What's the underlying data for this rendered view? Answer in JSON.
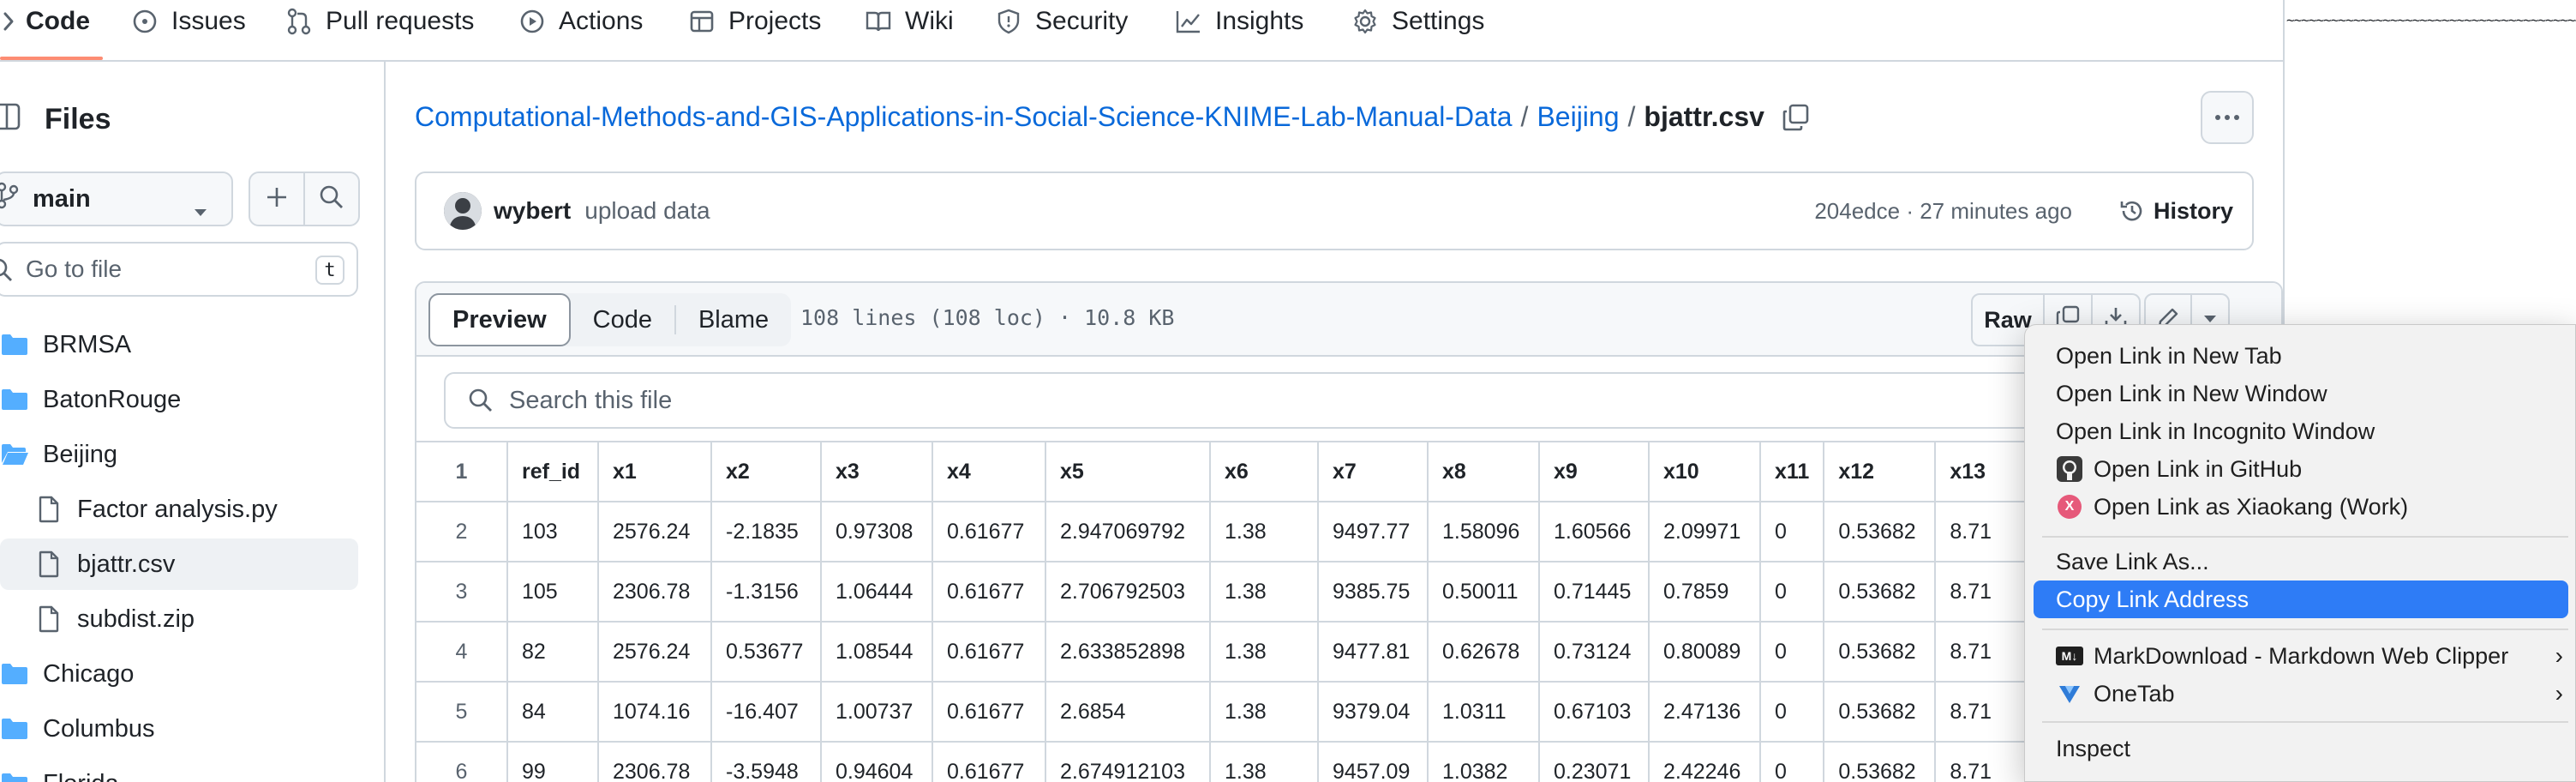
{
  "nav": {
    "tabs": [
      {
        "label": "Code",
        "icon": "code-icon",
        "active": true
      },
      {
        "label": "Issues",
        "icon": "issue-circle-icon"
      },
      {
        "label": "Pull requests",
        "icon": "pull-request-icon"
      },
      {
        "label": "Actions",
        "icon": "play-circle-icon"
      },
      {
        "label": "Projects",
        "icon": "table-icon"
      },
      {
        "label": "Wiki",
        "icon": "book-icon"
      },
      {
        "label": "Security",
        "icon": "shield-icon"
      },
      {
        "label": "Insights",
        "icon": "graph-icon"
      },
      {
        "label": "Settings",
        "icon": "gear-icon"
      }
    ],
    "overflow_text": "~~~~~~~~~~~~~~~~~~~~~~~~~~~~~~~~~~~~~~~~~~~~~~~~~~~~"
  },
  "sidebar": {
    "title": "Files",
    "branch": "main",
    "goto_placeholder": "Go to file",
    "goto_shortcut": "t",
    "items": [
      {
        "label": "BRMSA",
        "type": "folder"
      },
      {
        "label": "BatonRouge",
        "type": "folder"
      },
      {
        "label": "Beijing",
        "type": "folder-open"
      },
      {
        "label": "Factor analysis.py",
        "type": "file"
      },
      {
        "label": "bjattr.csv",
        "type": "file",
        "selected": true
      },
      {
        "label": "subdist.zip",
        "type": "file"
      },
      {
        "label": "Chicago",
        "type": "folder"
      },
      {
        "label": "Columbus",
        "type": "folder"
      },
      {
        "label": "Florida",
        "type": "folder"
      }
    ]
  },
  "breadcrumb": {
    "repo": "Computational-Methods-and-GIS-Applications-in-Social-Science-KNIME-Lab-Manual-Data",
    "folder": "Beijing",
    "file": "bjattr.csv",
    "separator": "/"
  },
  "commit": {
    "author": "wybert",
    "message": "upload data",
    "meta": "204edce · 27 minutes ago",
    "history_label": "History"
  },
  "file": {
    "views": [
      "Preview",
      "Code",
      "Blame"
    ],
    "active_view": "Preview",
    "stats": "108 lines (108 loc) · 10.8 KB",
    "raw_label": "Raw",
    "search_placeholder": "Search this file"
  },
  "table": {
    "headers": [
      "ref_id",
      "x1",
      "x2",
      "x3",
      "x4",
      "x5",
      "x6",
      "x7",
      "x8",
      "x9",
      "x10",
      "x11",
      "x12",
      "x13"
    ],
    "rows": [
      {
        "ln": "2",
        "cells": [
          "103",
          "2576.24",
          "-2.1835",
          "0.97308",
          "0.61677",
          "2.947069792",
          "1.38",
          "9497.77",
          "1.58096",
          "1.60566",
          "2.09971",
          "0",
          "0.53682",
          "8.71"
        ]
      },
      {
        "ln": "3",
        "cells": [
          "105",
          "2306.78",
          "-1.3156",
          "1.06444",
          "0.61677",
          "2.706792503",
          "1.38",
          "9385.75",
          "0.50011",
          "0.71445",
          "0.7859",
          "0",
          "0.53682",
          "8.71"
        ]
      },
      {
        "ln": "4",
        "cells": [
          "82",
          "2576.24",
          "0.53677",
          "1.08544",
          "0.61677",
          "2.633852898",
          "1.38",
          "9477.81",
          "0.62678",
          "0.73124",
          "0.80089",
          "0",
          "0.53682",
          "8.71"
        ]
      },
      {
        "ln": "5",
        "cells": [
          "84",
          "1074.16",
          "-16.407",
          "1.00737",
          "0.61677",
          "2.6854",
          "1.38",
          "9379.04",
          "1.0311",
          "0.67103",
          "2.47136",
          "0",
          "0.53682",
          "8.71"
        ]
      },
      {
        "ln": "6",
        "cells": [
          "99",
          "2306.78",
          "-3.5948",
          "0.94604",
          "0.61677",
          "2.674912103",
          "1.38",
          "9457.09",
          "1.0382",
          "0.23071",
          "2.42246",
          "0",
          "0.53682",
          "8.71"
        ]
      }
    ],
    "header_ln": "1"
  },
  "context_menu": {
    "items": [
      {
        "label": "Open Link in New Tab"
      },
      {
        "label": "Open Link in New Window"
      },
      {
        "label": "Open Link in Incognito Window"
      },
      {
        "label": "Open Link in GitHub",
        "icon": "github-icon"
      },
      {
        "label": "Open Link as Xiaokang (Work)",
        "icon": "profile-x-icon"
      },
      {
        "label": "Save Link As..."
      },
      {
        "label": "Copy Link Address",
        "highlighted": true
      },
      {
        "label": "MarkDownload - Markdown Web Clipper",
        "icon": "markdownload-icon",
        "submenu": true
      },
      {
        "label": "OneTab",
        "icon": "onetab-icon",
        "submenu": true
      },
      {
        "label": "Inspect"
      }
    ],
    "submenu_arrow": "›",
    "profile_letter": "X",
    "md_badge": "M↓",
    "highlight_color": "#2e7cf6"
  },
  "colors": {
    "link": "#0969da",
    "accent": "#fd8c73",
    "border": "#d0d7de"
  }
}
